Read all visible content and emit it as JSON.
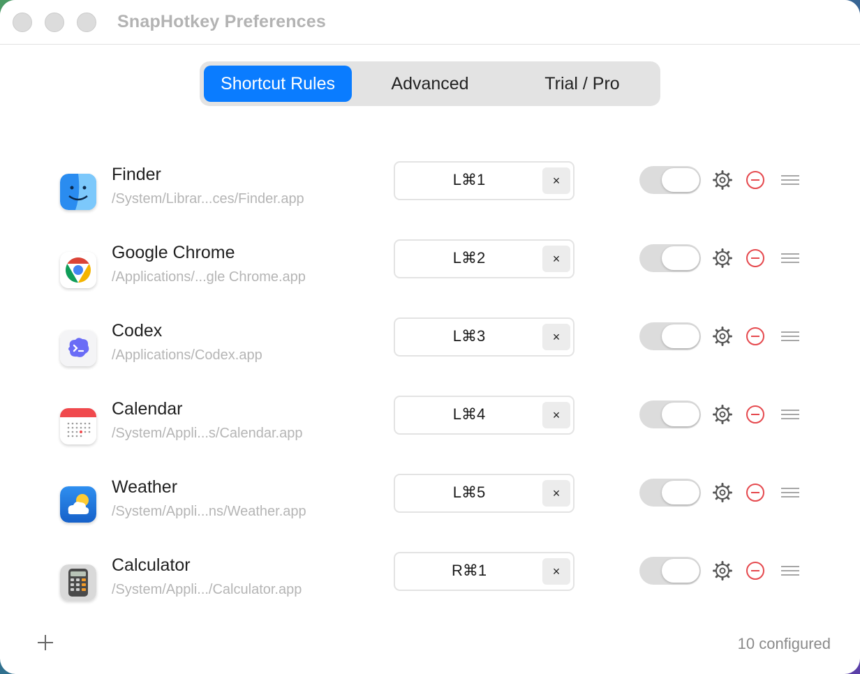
{
  "window": {
    "title": "SnapHotkey Preferences"
  },
  "tabs": [
    {
      "label": "Shortcut Rules",
      "active": true
    },
    {
      "label": "Advanced",
      "active": false
    },
    {
      "label": "Trial / Pro",
      "active": false
    }
  ],
  "rules": [
    {
      "name": "Finder",
      "path": "/System/Librar...ces/Finder.app",
      "shortcut": "L⌘1",
      "icon": "finder-icon",
      "enabled": true
    },
    {
      "name": "Google Chrome",
      "path": "/Applications/...gle Chrome.app",
      "shortcut": "L⌘2",
      "icon": "chrome-icon",
      "enabled": true
    },
    {
      "name": "Codex",
      "path": "/Applications/Codex.app",
      "shortcut": "L⌘3",
      "icon": "codex-icon",
      "enabled": true
    },
    {
      "name": "Calendar",
      "path": "/System/Appli...s/Calendar.app",
      "shortcut": "L⌘4",
      "icon": "calendar-icon",
      "enabled": true
    },
    {
      "name": "Weather",
      "path": "/System/Appli...ns/Weather.app",
      "shortcut": "L⌘5",
      "icon": "weather-icon",
      "enabled": true
    },
    {
      "name": "Calculator",
      "path": "/System/Appli.../Calculator.app",
      "shortcut": "R⌘1",
      "icon": "calculator-icon",
      "enabled": true
    }
  ],
  "clear_label": "×",
  "footer": {
    "configured": "10 configured"
  },
  "colors": {
    "accent": "#0a7cff",
    "remove": "#e5484d",
    "toggle_track": "#dcdcdc"
  }
}
